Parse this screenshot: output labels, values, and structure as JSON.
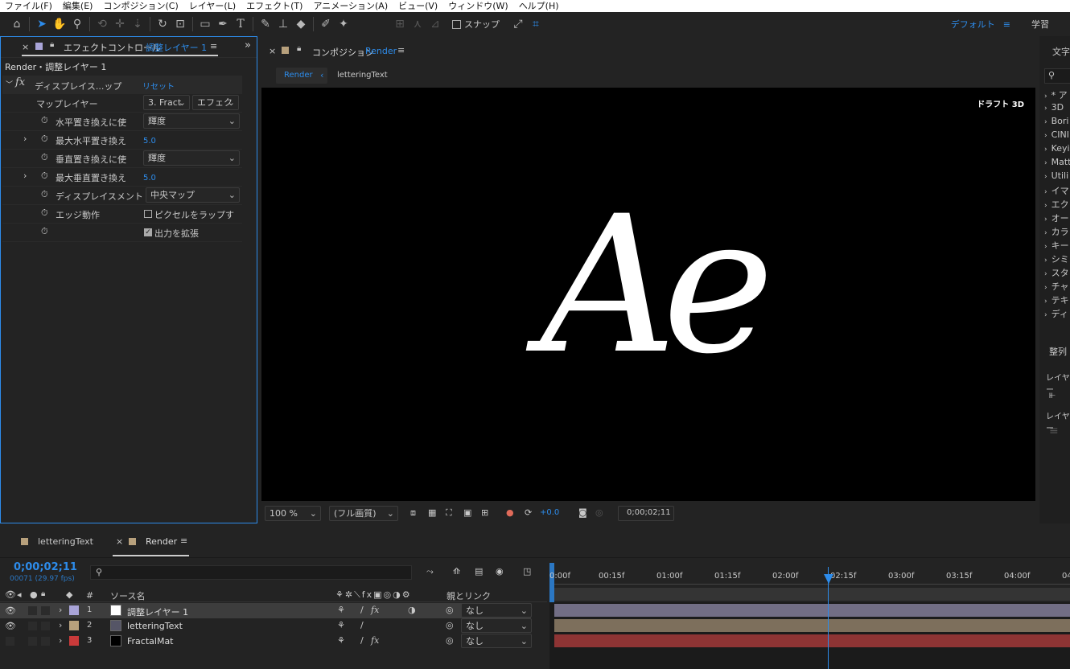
{
  "menu": [
    "ファイル(F)",
    "編集(E)",
    "コンポジション(C)",
    "レイヤー(L)",
    "エフェクト(T)",
    "アニメーション(A)",
    "ビュー(V)",
    "ウィンドウ(W)",
    "ヘルプ(H)"
  ],
  "toolbar": {
    "snap": "スナップ",
    "workspace": "デフォルト",
    "learn": "学習"
  },
  "effects_panel": {
    "tab_prefix": "エフェクトコントロール",
    "tab_layer": "調整レイヤー 1",
    "breadcrumb": "Render・調整レイヤー 1",
    "effect_name": "ディスプレイス...ップ",
    "reset": "リセット",
    "params": {
      "map_layer": {
        "label": "マップレイヤー",
        "v1": "3. Fract",
        "v2": "エフェク"
      },
      "h_use": {
        "label": "水平置き換えに使",
        "value": "輝度"
      },
      "h_max": {
        "label": "最大水平置き換え",
        "value": "5.0"
      },
      "v_use": {
        "label": "垂直置き換えに使",
        "value": "輝度"
      },
      "v_max": {
        "label": "最大垂直置き換え",
        "value": "5.0"
      },
      "disp": {
        "label": "ディスプレイスメント",
        "value": "中央マップ"
      },
      "edge": {
        "label": "エッジ動作",
        "value": "ピクセルをラップす"
      },
      "expand": {
        "value": "出力を拡張"
      }
    }
  },
  "comp_panel": {
    "tab_prefix": "コンポジション",
    "tab_name": "Render",
    "crumb_active": "Render",
    "crumb_other": "letteringText",
    "draft": "ドラフト 3D",
    "glyph": "Ae",
    "footer": {
      "zoom": "100 %",
      "quality": "(フル画質)",
      "exposure": "+0.0",
      "timecode": "0;00;02;11"
    }
  },
  "right_panel": {
    "title": "文字",
    "items": [
      "* ア",
      "3D ",
      "Bori",
      "CINI",
      "Keyi",
      "Matt",
      "Utili",
      "イマ",
      "エク",
      "オー",
      "カラ",
      "キー",
      "シミ",
      "スタ",
      "チャ",
      "テキ",
      "ディ"
    ],
    "align_title": "整列",
    "layer1": "レイヤー",
    "layer2": "レイヤー"
  },
  "timeline": {
    "tabs": [
      "letteringText",
      "Render"
    ],
    "timecode": "0;00;02;11",
    "fps": "00071 (29.97 fps)",
    "col_hash": "#",
    "col_source": "ソース名",
    "col_parent": "親とリンク",
    "layers": [
      {
        "num": "1",
        "name": "調整レイヤー 1",
        "parent": "なし",
        "label_color": "#a9a4d8",
        "fx": "fx"
      },
      {
        "num": "2",
        "name": "letteringText",
        "parent": "なし",
        "label_color": "#b7a07c",
        "fx": ""
      },
      {
        "num": "3",
        "name": "FractalMat",
        "parent": "なし",
        "label_color": "#c93a3a",
        "fx": "fx"
      }
    ],
    "ruler": [
      "0:00f",
      "00:15f",
      "01:00f",
      "01:15f",
      "02:00f",
      "02:15f",
      "03:00f",
      "03:15f",
      "04:00f",
      "04:"
    ]
  },
  "colors": {
    "accent": "#2d8ceb",
    "bar1": "#7c7891",
    "bar2": "#7d6f5c",
    "bar3": "#8e3434"
  }
}
